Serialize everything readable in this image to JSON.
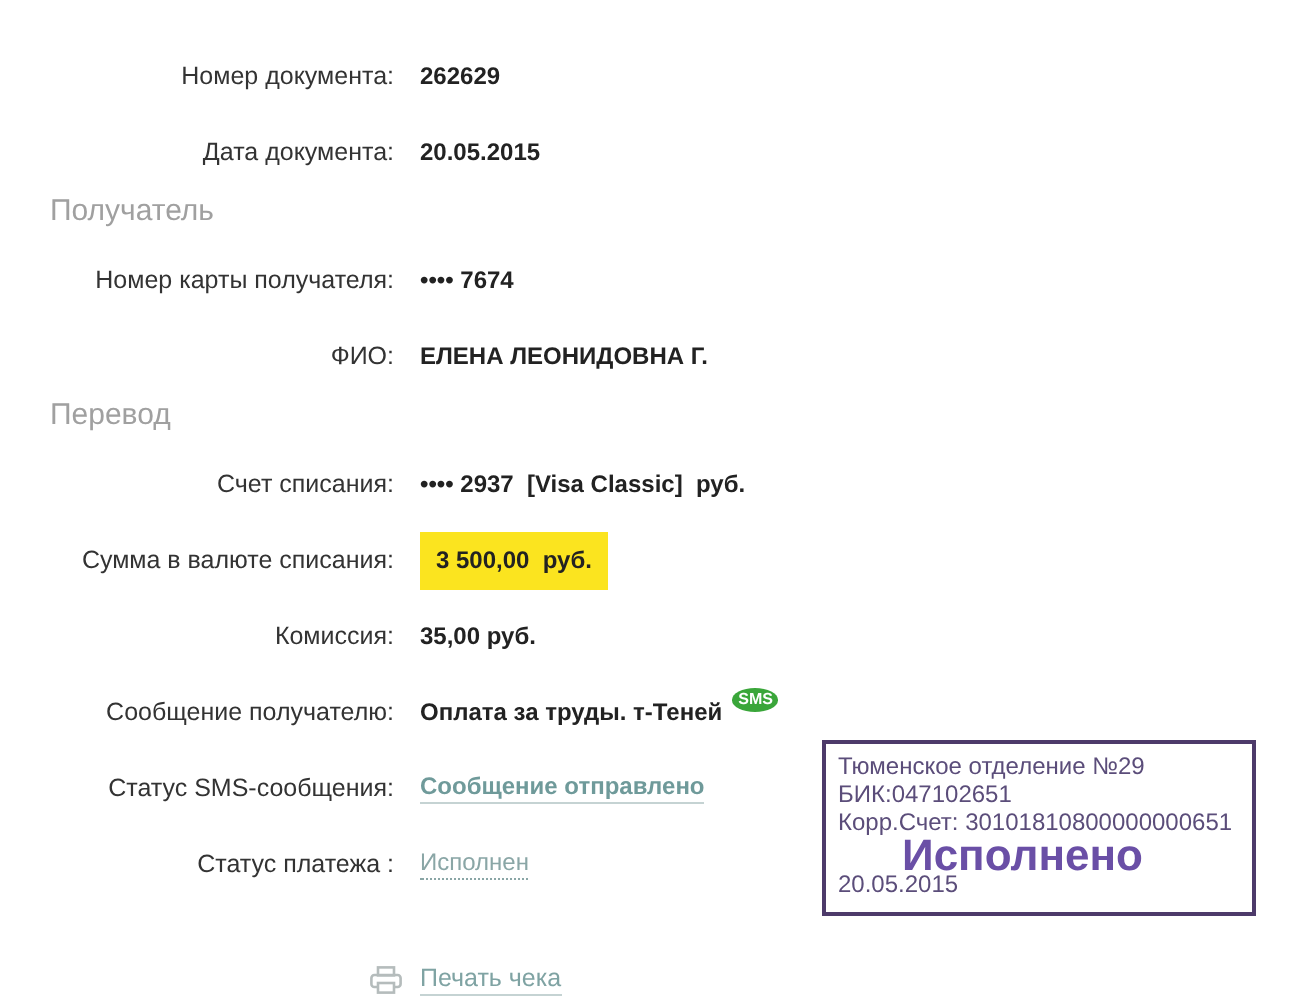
{
  "sections": [
    {
      "rows": [
        {
          "label": "Номер документа:",
          "value": "262629",
          "kind": "text"
        },
        {
          "label": "Дата документа:",
          "value": "20.05.2015",
          "kind": "text"
        }
      ]
    },
    {
      "title": "Получатель",
      "rows": [
        {
          "label": "Номер карты получателя:",
          "value": "•••• 7674",
          "kind": "text"
        },
        {
          "label": "ФИО:",
          "value": "ЕЛЕНА ЛЕОНИДОВНА Г.",
          "kind": "text"
        }
      ]
    },
    {
      "title": "Перевод",
      "rows": [
        {
          "label": "Счет списания:",
          "value": "•••• 2937  [Visa Classic]  руб.",
          "kind": "text"
        },
        {
          "label": "Сумма в валюте списания:",
          "value": "3 500,00  руб.",
          "kind": "highlight"
        },
        {
          "label": "Комиссия:",
          "value": "35,00 руб.",
          "kind": "text"
        },
        {
          "label": "Сообщение получателю:",
          "value": "Оплата за труды. т-Теней",
          "kind": "sms",
          "badge": "SMS"
        },
        {
          "label": "Статус SMS-сообщения:",
          "value": "Сообщение отправлено",
          "kind": "link"
        },
        {
          "label": "Статус платежа :",
          "value": "Исполнен",
          "kind": "status"
        }
      ]
    }
  ],
  "print_link": "Печать чека",
  "stamp": {
    "lines": [
      "Тюменское отделение №29",
      "БИК:047102651",
      "Корр.Счет: 30101810800000000651"
    ],
    "mark": "Исполнено",
    "date": "20.05.2015"
  }
}
